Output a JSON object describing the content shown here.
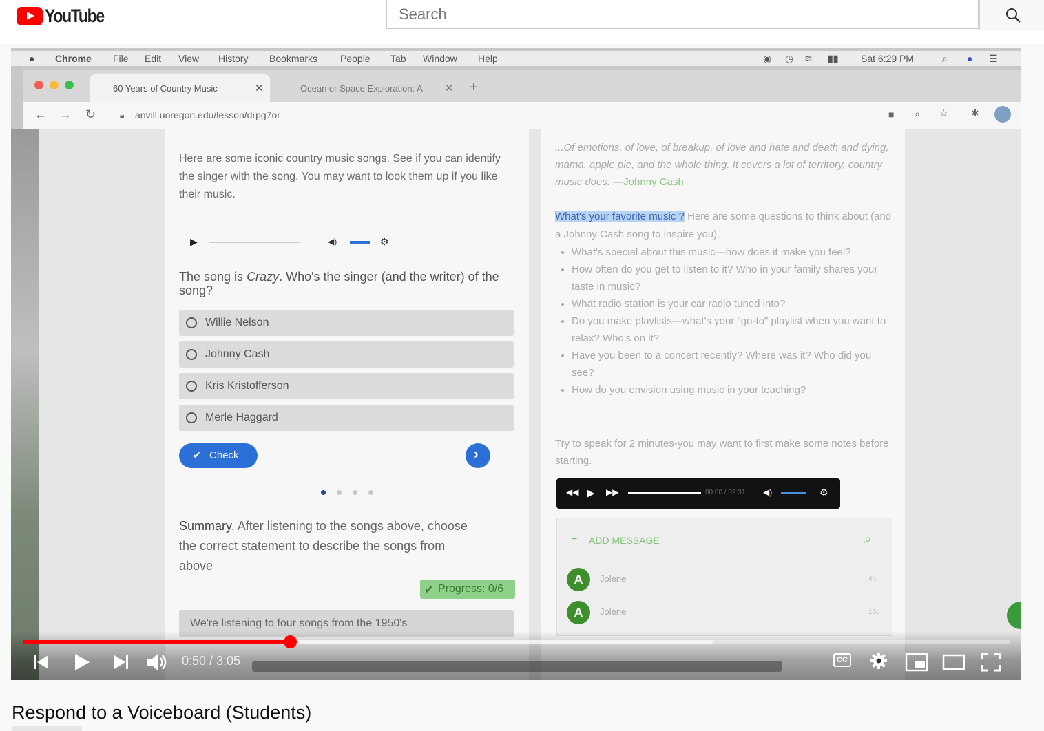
{
  "header": {
    "logo_text": "YouTube",
    "search_placeholder": "Search"
  },
  "video": {
    "mac_menu": [
      "Chrome",
      "File",
      "Edit",
      "View",
      "History",
      "Bookmarks",
      "People",
      "Tab",
      "Window",
      "Help"
    ],
    "clock": "Sat 6:29 PM",
    "tabs": [
      "60 Years of Country Music",
      "Ocean or Space Exploration: A"
    ],
    "url": "anvill.uoregon.edu/lesson/drpg7or",
    "left": {
      "intro": "Here are some iconic country music songs. See if you can identify the singer with the song. You may want to look them up if you like their music.",
      "question_prefix": "The song is ",
      "question_song": "Crazy",
      "question_suffix": ". Who's the singer (and the writer) of the song?",
      "options": [
        "Willie Nelson",
        "Johnny Cash",
        "Kris Kristofferson",
        "Merle Haggard"
      ],
      "check_label": "Check",
      "summary_label": "Summary",
      "summary_text": ". After listening to the songs above, choose the correct statement to describe the songs from above",
      "progress": "Progress: 0/6",
      "answer_preview": "We're listening to four songs from the 1950's"
    },
    "right": {
      "quote": "...Of emotions, of love, of breakup, of love and hate and death and dying, mama, apple pie, and the whole thing. It covers a lot of territory, country music does. —",
      "quote_author": "Johnny Cash",
      "highlight": "What's your favorite music ?",
      "prompt_rest": " Here are some questions to think about (and a Johnny Cash song to inspire you).",
      "bullets": [
        "What's special about this music—how does it make you feel?",
        "How often do you get to listen to it? Who in your family shares your taste in music?",
        "What radio station is your car radio tuned into?",
        "Do you make playlists—what's your \"go-to\" playlist when you want to relax? Who's on it?",
        "Have you been to a concert recently? Where was it? Who did you see?",
        "How do you envision using music in your teaching?"
      ],
      "instruction": "Try to speak for 2 minutes-you may want to first make some notes before starting.",
      "audio_time": "00:00 / 02:31",
      "add_message": "ADD MESSAGE",
      "messages": [
        {
          "name": "Jolene",
          "time": "4h"
        },
        {
          "name": "Jolene",
          "time": "10d"
        }
      ]
    }
  },
  "controls": {
    "time": "0:50 / 3:05",
    "progress_fraction": 0.2703,
    "buffered_fraction": 0.699,
    "cc_label": "CC"
  },
  "video_title": "Respond to a Voiceboard (Students)",
  "colors": {
    "accent": "#ff0000",
    "link": "#2c6fd6",
    "progress_bg": "#8fd08a"
  }
}
